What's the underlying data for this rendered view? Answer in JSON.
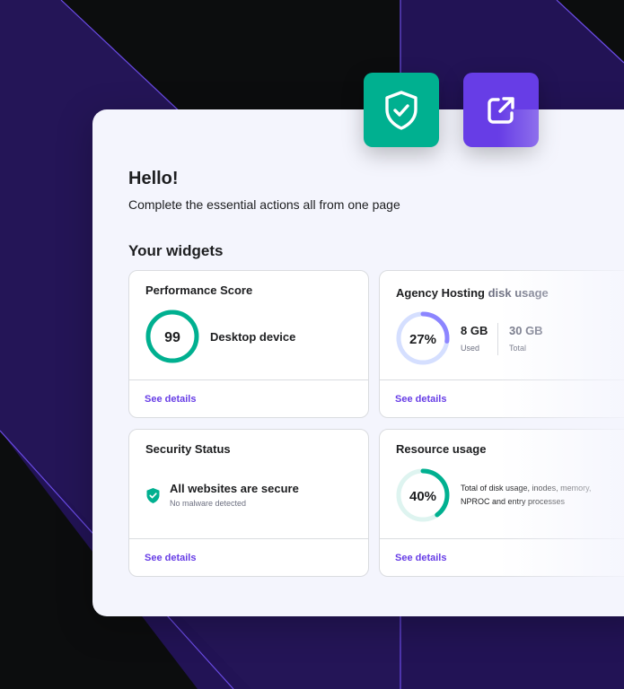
{
  "header": {
    "greeting": "Hello!",
    "subtitle": "Complete the essential actions all from one page",
    "widgets_title": "Your widgets"
  },
  "floating_buttons": [
    {
      "icon": "shield-check-icon",
      "color": "#00b090"
    },
    {
      "icon": "external-link-icon",
      "color": "#673de6"
    }
  ],
  "widgets": {
    "performance": {
      "title": "Performance Score",
      "score": "99",
      "score_fraction": 0.99,
      "device": "Desktop device",
      "link": "See details"
    },
    "disk": {
      "title_main": "Agency Hosting",
      "title_muted": "disk usage",
      "percent": "27%",
      "percent_value": 27,
      "used_value": "8 GB",
      "used_label": "Used",
      "total_value": "30 GB",
      "total_label": "Total",
      "link": "See details"
    },
    "security": {
      "title": "Security Status",
      "status": "All websites are secure",
      "detail": "No malware detected",
      "link": "See details"
    },
    "resource": {
      "title": "Resource usage",
      "percent": "40%",
      "percent_value": 40,
      "description": "Total of disk usage, inodes, memory, NPROC and entry processes",
      "link": "See details"
    }
  },
  "colors": {
    "accent_purple": "#673de6",
    "accent_green": "#00b090",
    "light_purple": "#d5dfff",
    "light_green": "#def4f0"
  }
}
